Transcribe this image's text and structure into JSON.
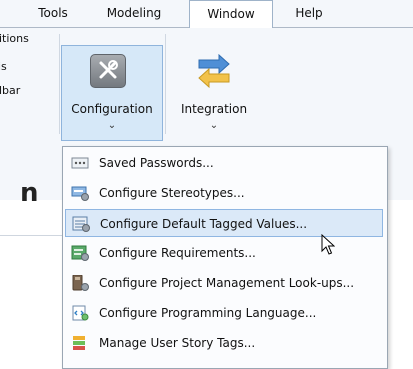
{
  "menubar": {
    "tabs": [
      {
        "label": "Tools"
      },
      {
        "label": "Modeling"
      },
      {
        "label": "Window"
      },
      {
        "label": "Help"
      }
    ]
  },
  "ribbon": {
    "left_items": [
      "itions",
      "is",
      "lbar"
    ],
    "configuration_label": "Configuration",
    "integration_label": "Integration",
    "dropdown_arrow": "⌄"
  },
  "background_heading": "n",
  "dropdown": {
    "items": [
      {
        "label": "Saved Passwords...",
        "icon": "password-icon"
      },
      {
        "label": "Configure Stereotypes...",
        "icon": "stereotype-icon"
      },
      {
        "label": "Configure Default Tagged Values...",
        "icon": "tagged-values-icon",
        "hovered": true
      },
      {
        "label": "Configure Requirements...",
        "icon": "requirements-icon"
      },
      {
        "label": "Configure Project Management Look-ups...",
        "icon": "project-management-icon"
      },
      {
        "label": "Configure Programming Language...",
        "icon": "programming-language-icon"
      },
      {
        "label": "Manage User Story Tags...",
        "icon": "user-story-tags-icon"
      }
    ]
  },
  "colors": {
    "hover_bg": "#dbe9f8",
    "hover_border": "#8fb6e2",
    "pressed_bg": "#d6e8f8"
  }
}
